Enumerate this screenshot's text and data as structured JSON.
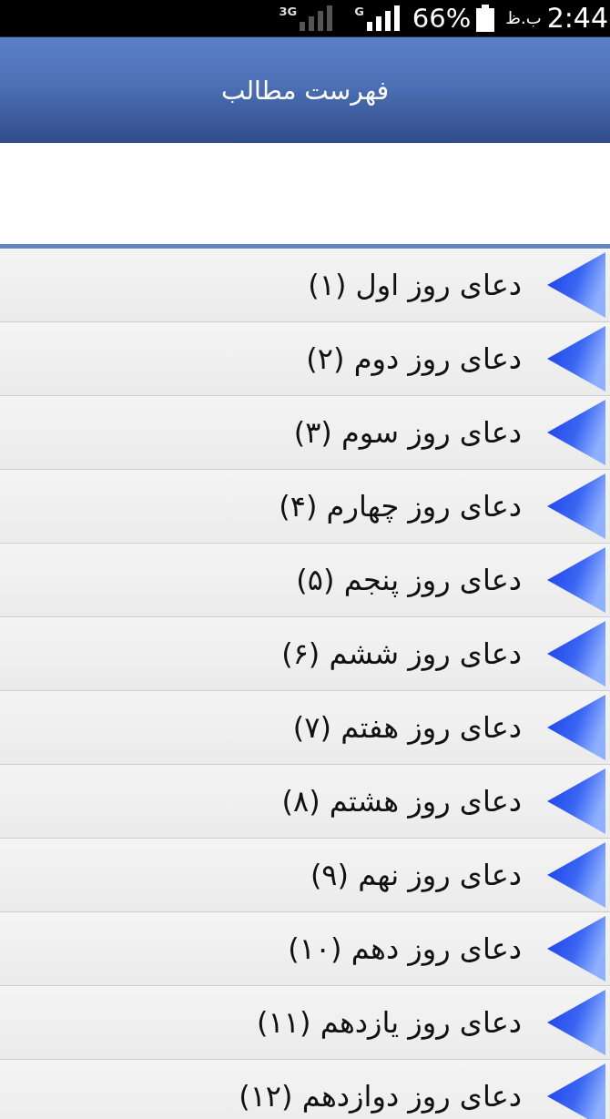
{
  "status_bar": {
    "networks": [
      {
        "label": "G",
        "active": true
      },
      {
        "label": "3G",
        "active": false
      }
    ],
    "battery": "66%",
    "period": "ب.ظ",
    "time": "2:44"
  },
  "header": {
    "title": "فهرست مطالب"
  },
  "items": [
    {
      "title": "دعای روز اول (۱)"
    },
    {
      "title": "دعای روز دوم (۲)"
    },
    {
      "title": "دعای روز سوم (۳)"
    },
    {
      "title": "دعای روز چهارم (۴)"
    },
    {
      "title": "دعای روز پنجم (۵)"
    },
    {
      "title": "دعای روز ششم (۶)"
    },
    {
      "title": "دعای روز هفتم (۷)"
    },
    {
      "title": "دعای روز هشتم (۸)"
    },
    {
      "title": "دعای روز نهم (۹)"
    },
    {
      "title": "دعای روز دهم (۱۰)"
    },
    {
      "title": "دعای روز یازدهم (۱۱)"
    },
    {
      "title": "دعای روز دوازدهم (۱۲)"
    }
  ]
}
